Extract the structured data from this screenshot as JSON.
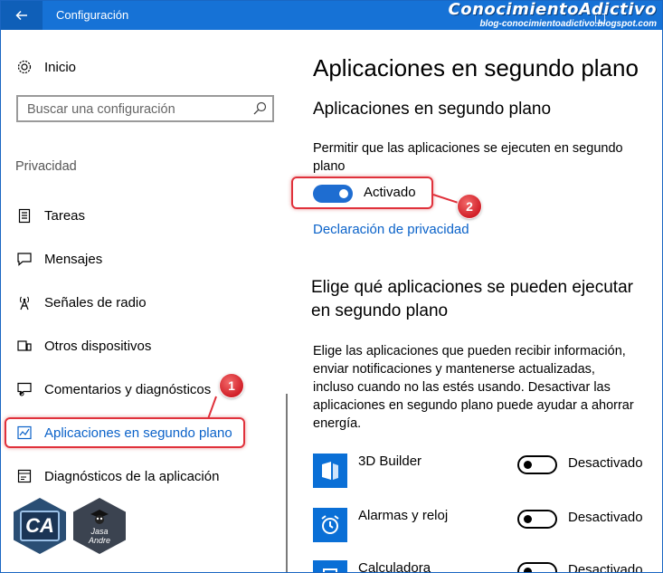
{
  "titlebar": {
    "title": "Configuración",
    "brand_main": "ConocimientoAdictivo",
    "brand_sub": "blog-conocimientoadictivo.blogspot.com"
  },
  "sidebar": {
    "home_label": "Inicio",
    "search": {
      "placeholder": "Buscar una configuración"
    },
    "section_label": "Privacidad",
    "items": [
      {
        "label": "Tareas",
        "icon": "clipboard-icon"
      },
      {
        "label": "Mensajes",
        "icon": "chat-icon"
      },
      {
        "label": "Señales de radio",
        "icon": "radio-tower-icon"
      },
      {
        "label": "Otros dispositivos",
        "icon": "devices-icon"
      },
      {
        "label": "Comentarios y diagnósticos",
        "icon": "feedback-icon"
      },
      {
        "label": "Aplicaciones en segundo plano",
        "icon": "background-apps-icon",
        "active": true
      },
      {
        "label": "Diagnósticos de la aplicación",
        "icon": "app-diagnostics-icon"
      }
    ],
    "badge_1": "1",
    "logos": {
      "ca": "CA",
      "ja_line1": "Jasa",
      "ja_line2": "Andre"
    }
  },
  "main": {
    "page_title": "Aplicaciones en segundo plano",
    "section_title": "Aplicaciones en segundo plano",
    "allow_desc": "Permitir que las aplicaciones se ejecuten en segundo plano",
    "toggle_state": "Activado",
    "badge_2": "2",
    "privacy_link": "Declaración de privacidad",
    "choose_title": "Elige qué aplicaciones se pueden ejecutar en segundo plano",
    "choose_desc": "Elige las aplicaciones que pueden recibir información, enviar notificaciones y mantenerse actualizadas, incluso cuando no las estés usando. Desactivar las aplicaciones en segundo plano puede ayudar a ahorrar energía.",
    "apps": [
      {
        "name": "3D Builder",
        "state": "Desactivado"
      },
      {
        "name": "Alarmas y reloj",
        "state": "Desactivado"
      },
      {
        "name": "Calculadora",
        "state": "Desactivado"
      }
    ]
  },
  "colors": {
    "accent": "#1672d6",
    "link": "#0a62c9",
    "highlight": "#e0313b"
  }
}
